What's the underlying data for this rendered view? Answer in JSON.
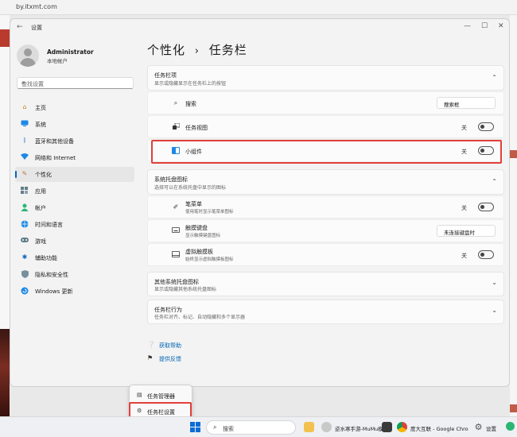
{
  "browser": {
    "url": "by.itxmt.com"
  },
  "window": {
    "title": "设置",
    "controls": {
      "minimize": "—",
      "maximize": "☐",
      "close": "✕"
    }
  },
  "user": {
    "name": "Administrator",
    "account": "本地帐户"
  },
  "search": {
    "placeholder": "查找设置"
  },
  "sidebar": {
    "items": [
      {
        "label": "主页",
        "icon": "home-icon"
      },
      {
        "label": "系统",
        "icon": "system-icon"
      },
      {
        "label": "蓝牙和其他设备",
        "icon": "bluetooth-icon"
      },
      {
        "label": "网络和 Internet",
        "icon": "wifi-icon"
      },
      {
        "label": "个性化",
        "icon": "brush-icon",
        "active": true
      },
      {
        "label": "应用",
        "icon": "apps-icon"
      },
      {
        "label": "帐户",
        "icon": "account-icon"
      },
      {
        "label": "时间和语言",
        "icon": "globe-icon"
      },
      {
        "label": "游戏",
        "icon": "gamepad-icon"
      },
      {
        "label": "辅助功能",
        "icon": "accessibility-icon"
      },
      {
        "label": "隐私和安全性",
        "icon": "shield-icon"
      },
      {
        "label": "Windows 更新",
        "icon": "update-icon"
      }
    ]
  },
  "main": {
    "breadcrumb": {
      "parent": "个性化",
      "separator": "›",
      "current": "任务栏"
    },
    "taskbar_items": {
      "title": "任务栏项",
      "subtitle": "显示或隐藏显示在任务栏上的按钮",
      "rows": [
        {
          "label": "搜索",
          "icon": "search-icon",
          "dropdown": "搜索框"
        },
        {
          "label": "任务视图",
          "icon": "task-view-icon",
          "toggle_label": "关"
        },
        {
          "label": "小组件",
          "icon": "widgets-icon",
          "toggle_label": "关"
        }
      ]
    },
    "tray_icons": {
      "title": "系统托盘图标",
      "subtitle": "选择可以在系统托盘中显示的图标",
      "rows": [
        {
          "label": "笔菜单",
          "sub": "使用笔时显示笔菜单图标",
          "icon": "pen-icon",
          "toggle_label": "关"
        },
        {
          "label": "触摸键盘",
          "sub": "显示触摸键盘图标",
          "icon": "keyboard-icon",
          "dropdown": "未连接键盘时"
        },
        {
          "label": "虚拟触摸板",
          "sub": "始终显示虚拟触摸板图标",
          "icon": "touchpad-icon",
          "toggle_label": "关"
        }
      ]
    },
    "other_tray": {
      "title": "其他系统托盘图标",
      "subtitle": "显示或隐藏其他系统托盘图标"
    },
    "behaviors": {
      "title": "任务栏行为",
      "subtitle": "任务栏对齐、标记、自动隐藏和多个显示器"
    },
    "help": {
      "get_help": "获取帮助",
      "feedback": "提供反馈"
    }
  },
  "context_menu": {
    "items": [
      {
        "label": "任务管理器",
        "icon": "task-manager-icon"
      },
      {
        "label": "任务栏设置",
        "icon": "gear-icon"
      }
    ]
  },
  "taskbar": {
    "search_label": "搜索",
    "apps": [
      {
        "label": "",
        "icon": "folder-icon"
      },
      {
        "label": "逆水寒手游-MuMu模拟",
        "icon": "mumu-icon"
      },
      {
        "label": "",
        "icon": "app-icon"
      },
      {
        "label": "度大互联 - Google Chro",
        "icon": "chrome-icon"
      },
      {
        "label": "设置",
        "icon": "settings-gear-icon"
      }
    ]
  },
  "colors": {
    "accent": "#0067c0",
    "highlight": "#e0403a",
    "link": "#0063b1"
  }
}
